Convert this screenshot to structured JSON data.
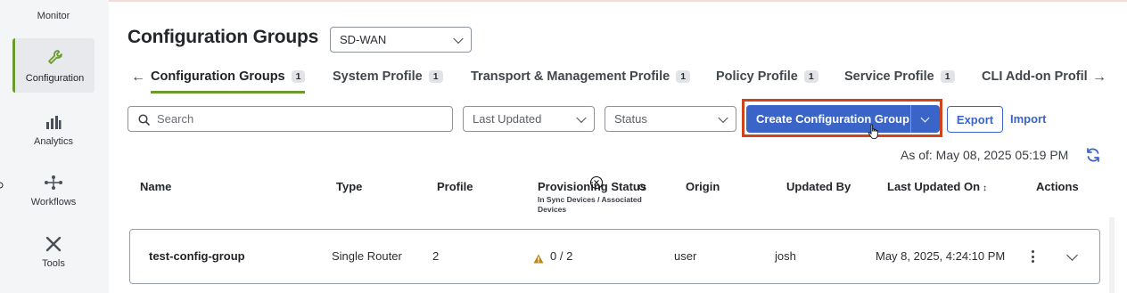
{
  "sidebar": {
    "items": [
      {
        "label": "Monitor",
        "icon": "monitor-icon"
      },
      {
        "label": "Configuration",
        "icon": "wrench-icon",
        "active": true
      },
      {
        "label": "Analytics",
        "icon": "bar-chart-icon"
      },
      {
        "label": "Workflows",
        "icon": "workflow-icon"
      },
      {
        "label": "Tools",
        "icon": "tools-icon"
      }
    ]
  },
  "header": {
    "title": "Configuration Groups",
    "solution_select": "SD-WAN"
  },
  "tabs": [
    {
      "label": "Configuration Groups",
      "count": "1",
      "active": true
    },
    {
      "label": "System Profile",
      "count": "1"
    },
    {
      "label": "Transport & Management Profile",
      "count": "1"
    },
    {
      "label": "Policy Profile",
      "count": "1"
    },
    {
      "label": "Service Profile",
      "count": "1"
    },
    {
      "label": "CLI Add-on Profil"
    }
  ],
  "filters": {
    "search_placeholder": "Search",
    "sort_select": "Last Updated",
    "status_select": "Status"
  },
  "actions": {
    "create_label": "Create Configuration Group",
    "export_label": "Export",
    "import_label": "Import"
  },
  "as_of": "As of: May 08, 2025 05:19 PM",
  "table": {
    "columns": {
      "name": "Name",
      "type": "Type",
      "profile": "Profile",
      "provisioning": "Provisioning Status",
      "provisioning_sub": "In Sync Devices / Associated Devices",
      "origin": "Origin",
      "updated_by": "Updated By",
      "last_updated_on": "Last Updated On",
      "actions": "Actions"
    },
    "rows": [
      {
        "name": "test-config-group",
        "type": "Single Router",
        "profile": "2",
        "provisioning": "0 / 2",
        "origin": "user",
        "updated_by": "josh",
        "last_updated_on": "May 8, 2025, 4:24:10 PM"
      }
    ]
  },
  "colors": {
    "accent_green": "#6b9a2e",
    "primary_blue": "#3b64c8",
    "highlight_red": "#d0431c",
    "warning": "#b8861b"
  }
}
